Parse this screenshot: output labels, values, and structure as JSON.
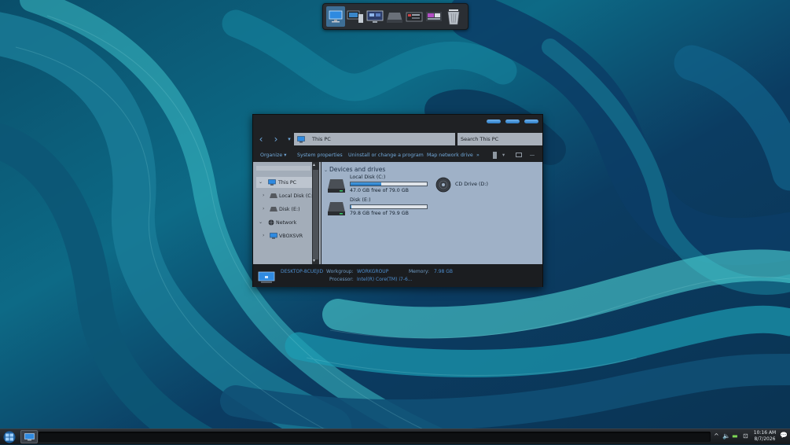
{
  "desktop": {
    "wallpaper": "abstract teal and blue wave pattern",
    "colors": {
      "accent": "#3d7fc4",
      "window_bg": "#1f2124",
      "content_bg": "#9fb1c7",
      "nav_bg": "#a3adb9"
    }
  },
  "dock": {
    "items": [
      "this-pc-icon",
      "computer-icon",
      "monitor-icon",
      "hard-drive-icon",
      "settings-panel-icon",
      "hardware-icon",
      "recycle-bin-icon"
    ]
  },
  "explorer": {
    "address": "This PC",
    "search_placeholder": "Search This PC",
    "command_bar": {
      "organize": "Organize ▾",
      "system_properties": "System properties",
      "uninstall": "Uninstall or change a program",
      "map_drive": "Map network drive",
      "more": "»"
    },
    "nav_pane": {
      "items": [
        {
          "label": "This PC",
          "icon": "this-pc-icon",
          "selected": true
        },
        {
          "label": "Local Disk (C:)",
          "icon": "drive-icon"
        },
        {
          "label": "Disk (E:)",
          "icon": "drive-icon"
        },
        {
          "label": "Network",
          "icon": "network-icon"
        },
        {
          "label": "VBOXSVR",
          "icon": "network-share-icon"
        }
      ]
    },
    "content": {
      "group_header": "Devices and drives",
      "drives": [
        {
          "name": "Local Disk (C:)",
          "free_text": "47.0 GB free of 79.0 GB",
          "used_fraction": 0.405
        },
        {
          "name": "Disk (E:)",
          "free_text": "79.8 GB free of 79.9 GB",
          "used_fraction": 0.002
        }
      ],
      "cd_drive": "CD Drive (D:)"
    },
    "details": {
      "computer_name": "DESKTOP-8CUEJID",
      "workgroup_label": "Workgroup:",
      "workgroup_value": "WORKGROUP",
      "memory_label": "Memory:",
      "memory_value": "7.98 GB",
      "processor_label": "Processor:",
      "processor_value": "Intel(R) Core(TM) i7-6..."
    }
  },
  "taskbar": {
    "time": "10:16 AM",
    "date": "8/7/2026",
    "tray_icons": [
      "chevron-up-icon",
      "volume-icon",
      "battery-icon",
      "network-icon",
      "display-icon",
      "notification-icon"
    ]
  }
}
